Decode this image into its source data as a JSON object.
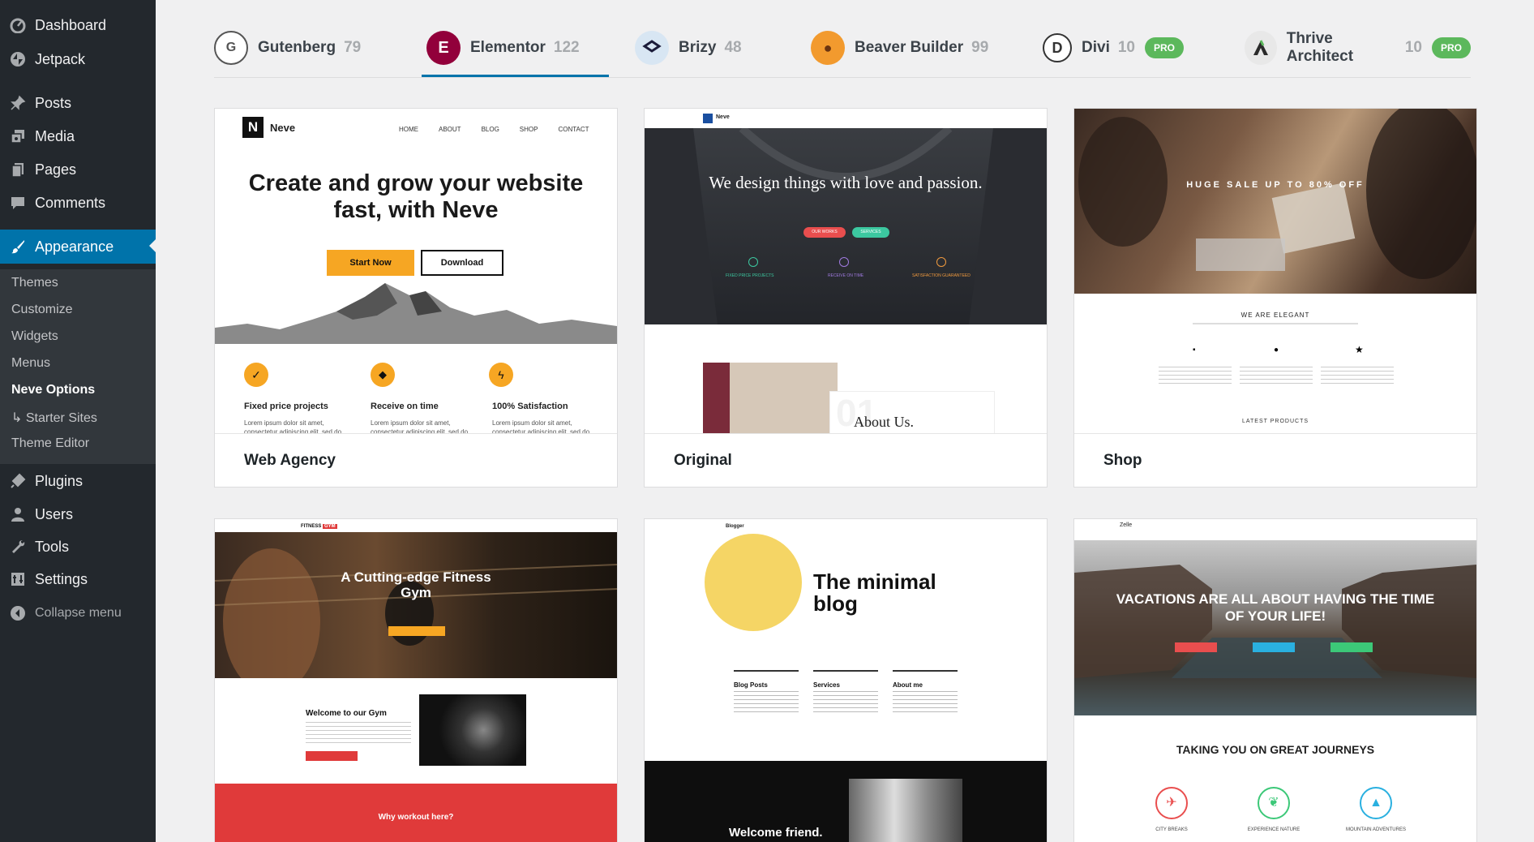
{
  "sidebar": {
    "dashboard": "Dashboard",
    "jetpack": "Jetpack",
    "posts": "Posts",
    "media": "Media",
    "pages": "Pages",
    "comments": "Comments",
    "appearance": "Appearance",
    "submenu": [
      "Themes",
      "Customize",
      "Widgets",
      "Menus",
      "Neve Options",
      "↳ Starter Sites",
      "Theme Editor"
    ],
    "plugins": "Plugins",
    "users": "Users",
    "tools": "Tools",
    "settings": "Settings",
    "collapse": "Collapse menu"
  },
  "tabs": [
    {
      "label": "Gutenberg",
      "count": "79"
    },
    {
      "label": "Elementor",
      "count": "122"
    },
    {
      "label": "Brizy",
      "count": "48"
    },
    {
      "label": "Beaver Builder",
      "count": "99"
    },
    {
      "label": "Divi",
      "count": "10",
      "badge": "PRO"
    },
    {
      "label": "Thrive Architect",
      "count": "10",
      "badge": "PRO"
    }
  ],
  "cards": {
    "web_agency": {
      "title": "Web Agency",
      "brand": "Neve",
      "nav": [
        "HOME",
        "ABOUT",
        "BLOG",
        "SHOP",
        "CONTACT"
      ],
      "headline": "Create and grow your website fast, with Neve",
      "btn1": "Start Now",
      "btn2": "Download",
      "features": [
        "Fixed price projects",
        "Receive on time",
        "100% Satisfaction"
      ],
      "lorem": "Lorem ipsum dolor sit amet, consectetur adipiscing elit, sed do"
    },
    "original": {
      "title": "Original",
      "brand": "Neve",
      "headline": "We design things with love and passion.",
      "btn1": "OUR WORKS",
      "btn2": "SERVICES",
      "features": [
        "FIXED PRICE PROJECTS",
        "RECEIVE ON TIME",
        "SATISFACTION GUARANTEED"
      ],
      "about": "About Us."
    },
    "shop": {
      "title": "Shop",
      "sale": "HUGE SALE UP TO 80% OFF",
      "elegant": "WE ARE ELEGANT",
      "latest": "LATEST PRODUCTS"
    },
    "fitness": {
      "headline": "A Cutting-edge Fitness Gym",
      "welcome": "Welcome to our Gym",
      "why": "Why workout here?"
    },
    "blogger": {
      "brand": "Blogger",
      "headline": "The minimal blog",
      "cols": [
        "Blog Posts",
        "Services",
        "About me"
      ],
      "welcome": "Welcome friend."
    },
    "travel": {
      "brand": "Zelle",
      "headline": "VACATIONS ARE ALL ABOUT HAVING THE TIME OF YOUR LIFE!",
      "journeys": "TAKING YOU ON GREAT JOURNEYS",
      "icons": [
        "CITY BREAKS",
        "EXPERIENCE NATURE",
        "MOUNTAIN ADVENTURES"
      ]
    }
  }
}
